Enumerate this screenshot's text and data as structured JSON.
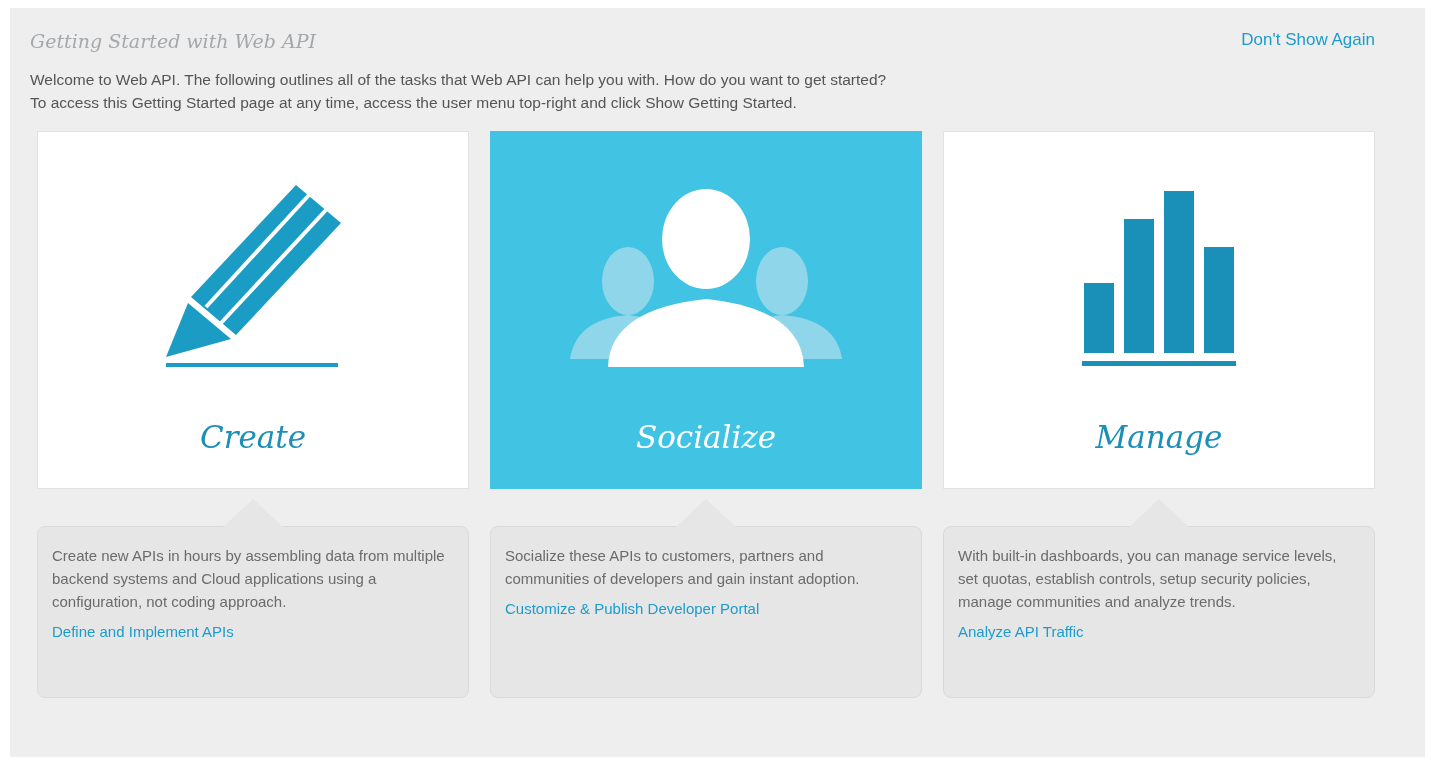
{
  "header": {
    "title": "Getting Started with Web API",
    "dismiss_link": "Don't Show Again"
  },
  "intro": [
    "Welcome to Web API. The following outlines all of the tasks that Web API can help you with. How do you want to get started?",
    "To access this Getting Started page at any time, access the user menu top-right and click Show Getting Started."
  ],
  "cards": [
    {
      "kind": "pencil",
      "title": "Create",
      "selected": false,
      "description": "Create new APIs in hours by assembling data from multiple backend systems and Cloud applications using a configuration, not coding approach.",
      "link": "Define and Implement APIs"
    },
    {
      "kind": "people",
      "title": "Socialize",
      "selected": true,
      "description": "Socialize these APIs to customers, partners and communities of developers and gain instant adoption.",
      "link": "Customize & Publish Developer Portal"
    },
    {
      "kind": "bars",
      "title": "Manage",
      "selected": false,
      "description": "With built-in dashboards, you can manage service levels, set quotas, establish controls, setup security policies, manage communities and analyze trends.",
      "link": "Analyze API Traffic"
    }
  ]
}
